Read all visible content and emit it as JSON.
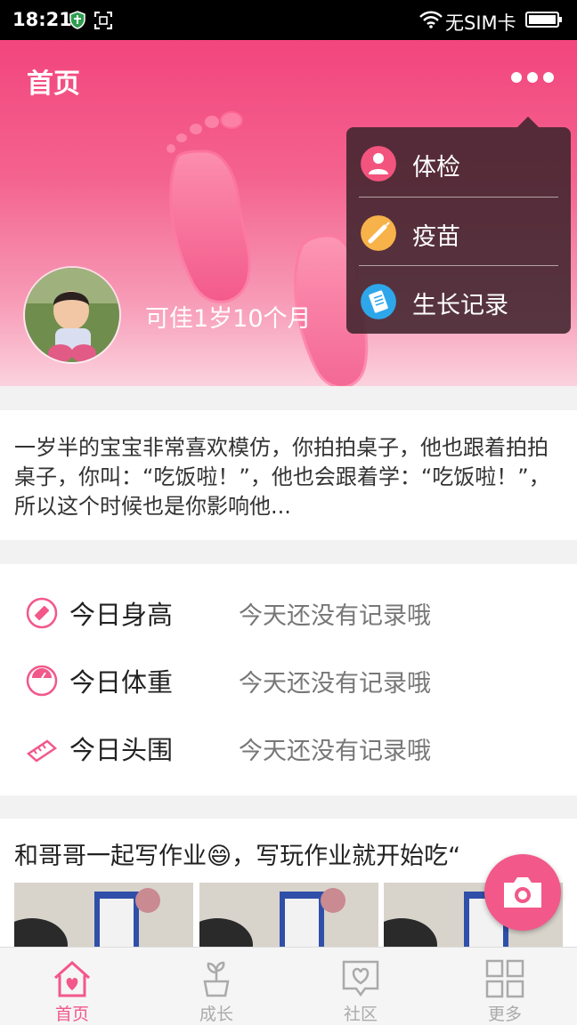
{
  "status_bar": {
    "time": "18:21",
    "sim": "无SIM卡"
  },
  "header": {
    "title": "首页",
    "baby_name_age": "可佳1岁10个月"
  },
  "menu": {
    "items": [
      {
        "label": "体检",
        "icon": "checkup-icon",
        "color": "#f2547e"
      },
      {
        "label": "疫苗",
        "icon": "vaccine-icon",
        "color": "#f7b24a"
      },
      {
        "label": "生长记录",
        "icon": "growth-record-icon",
        "color": "#2ea6ea"
      }
    ]
  },
  "tip": {
    "text": "一岁半的宝宝非常喜欢模仿，你拍拍桌子，他也跟着拍拍桌子，你叫：“吃饭啦！”，他也会跟着学：“吃饭啦！”，所以这个时候也是你影响他..."
  },
  "records": [
    {
      "label": "今日身高",
      "value": "今天还没有记录哦",
      "icon": "ruler-icon"
    },
    {
      "label": "今日体重",
      "value": "今天还没有记录哦",
      "icon": "scale-icon"
    },
    {
      "label": "今日头围",
      "value": "今天还没有记录哦",
      "icon": "tape-measure-icon"
    }
  ],
  "diary": {
    "text": "和哥哥一起写作业😄，写玩作业就开始吃“"
  },
  "nav": {
    "tabs": [
      {
        "label": "首页",
        "icon": "home-icon",
        "active": true
      },
      {
        "label": "成长",
        "icon": "sprout-icon",
        "active": false
      },
      {
        "label": "社区",
        "icon": "community-icon",
        "active": false
      },
      {
        "label": "更多",
        "icon": "grid-icon",
        "active": false
      }
    ]
  },
  "colors": {
    "accent": "#f2588a",
    "banner_top": "#f2457d"
  }
}
